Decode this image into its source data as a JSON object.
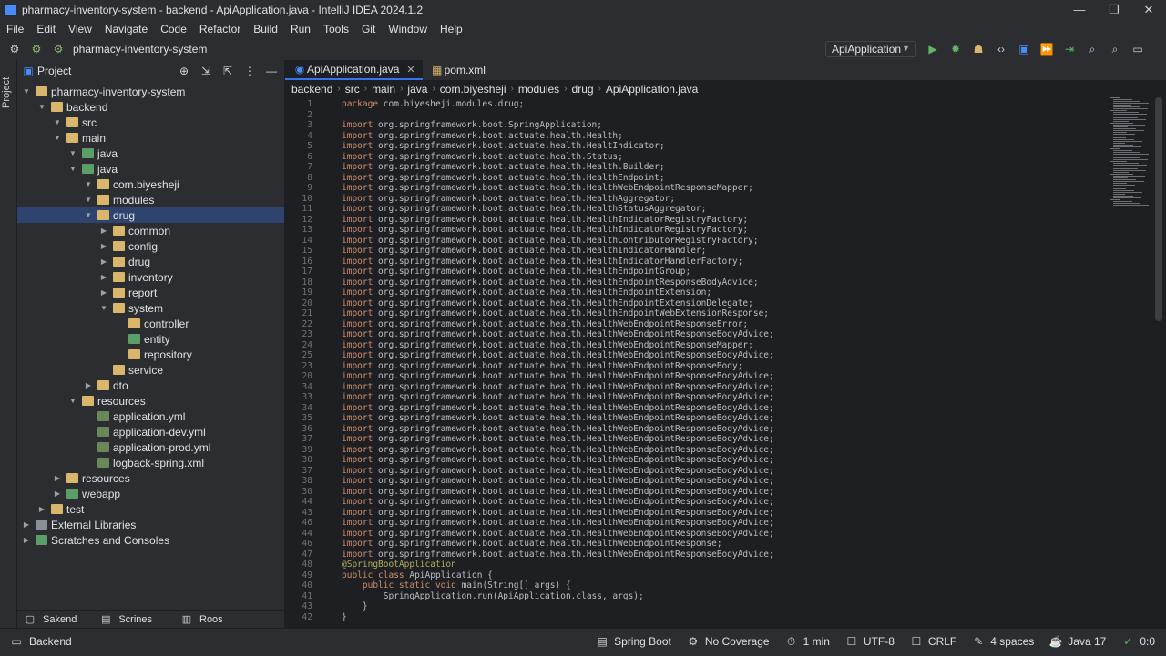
{
  "window": {
    "title": "pharmacy-inventory-system - backend - ApiApplication.java - IntelliJ IDEA 2024.1.2",
    "controls": [
      "—",
      "❐",
      "✕"
    ]
  },
  "menu": [
    "File",
    "Edit",
    "View",
    "Navigate",
    "Code",
    "Refactor",
    "Build",
    "Run",
    "Tools",
    "Git",
    "Window",
    "Help"
  ],
  "toolbar": {
    "project_name": "pharmacy-inventory-system",
    "run_config": "ApiApplication"
  },
  "left_strip": {
    "label": "Project"
  },
  "project_panel": {
    "title": "Project",
    "tree": [
      {
        "label": "pharmacy-inventory-system",
        "depth": 0,
        "arrow": "v",
        "icon": "folder"
      },
      {
        "label": "backend",
        "depth": 1,
        "arrow": "v",
        "icon": "folder"
      },
      {
        "label": "src",
        "depth": 2,
        "arrow": "v",
        "icon": "folder"
      },
      {
        "label": "main",
        "depth": 2,
        "arrow": "v",
        "icon": "folder"
      },
      {
        "label": "java",
        "depth": 3,
        "arrow": "v",
        "icon": "srcfolder"
      },
      {
        "label": "java",
        "depth": 3,
        "arrow": "v",
        "icon": "srcfolder"
      },
      {
        "label": "com.biyesheji",
        "depth": 4,
        "arrow": "v",
        "icon": "folder"
      },
      {
        "label": "modules",
        "depth": 4,
        "arrow": "v",
        "icon": "folder"
      },
      {
        "label": "drug",
        "depth": 4,
        "arrow": "v",
        "icon": "folder",
        "selected": true
      },
      {
        "label": "common",
        "depth": 5,
        "arrow": ">",
        "icon": "folder"
      },
      {
        "label": "config",
        "depth": 5,
        "arrow": ">",
        "icon": "folder"
      },
      {
        "label": "drug",
        "depth": 5,
        "arrow": ">",
        "icon": "folder"
      },
      {
        "label": "inventory",
        "depth": 5,
        "arrow": ">",
        "icon": "folder"
      },
      {
        "label": "report",
        "depth": 5,
        "arrow": ">",
        "icon": "folder"
      },
      {
        "label": "system",
        "depth": 5,
        "arrow": "v",
        "icon": "folder"
      },
      {
        "label": "controller",
        "depth": 6,
        "arrow": "",
        "icon": "folder"
      },
      {
        "label": "entity",
        "depth": 6,
        "arrow": "",
        "icon": "srcfolder"
      },
      {
        "label": "repository",
        "depth": 6,
        "arrow": "",
        "icon": "folder"
      },
      {
        "label": "service",
        "depth": 5,
        "arrow": "",
        "icon": "folder"
      },
      {
        "label": "dto",
        "depth": 4,
        "arrow": ">",
        "icon": "folder"
      },
      {
        "label": "resources",
        "depth": 3,
        "arrow": "v",
        "icon": "folder"
      },
      {
        "label": "application.yml",
        "depth": 4,
        "arrow": "",
        "icon": "yml"
      },
      {
        "label": "application-dev.yml",
        "depth": 4,
        "arrow": "",
        "icon": "yml"
      },
      {
        "label": "application-prod.yml",
        "depth": 4,
        "arrow": "",
        "icon": "yml"
      },
      {
        "label": "logback-spring.xml",
        "depth": 4,
        "arrow": "",
        "icon": "yml"
      },
      {
        "label": "resources",
        "depth": 2,
        "arrow": ">",
        "icon": "folder"
      },
      {
        "label": "webapp",
        "depth": 2,
        "arrow": ">",
        "icon": "srcfolder"
      },
      {
        "label": "test",
        "depth": 1,
        "arrow": ">",
        "icon": "folder"
      },
      {
        "label": "External Libraries",
        "depth": 0,
        "arrow": ">",
        "icon": "libicon"
      },
      {
        "label": "Scratches and Consoles",
        "depth": 0,
        "arrow": ">",
        "icon": "srcfolder"
      }
    ]
  },
  "bottom_tabs": [
    "Sakend",
    "Scrines",
    "Roos"
  ],
  "editor": {
    "tabs": [
      {
        "label": "ApiApplication.java",
        "active": true
      },
      {
        "label": "pom.xml",
        "active": false
      }
    ],
    "breadcrumb": [
      "backend",
      "src",
      "main",
      "java",
      "com.biyesheji",
      "modules",
      "drug",
      "ApiApplication.java"
    ],
    "lines": [
      {
        "n": "1",
        "text": "package com.biyesheji.modules.drug;"
      },
      {
        "n": "2",
        "text": ""
      },
      {
        "n": "3",
        "text": "import org.springframework.boot.SpringApplication;"
      },
      {
        "n": "4",
        "text": "import org.springframework.boot.actuate.health.Health;"
      },
      {
        "n": "5",
        "text": "import org.springframework.boot.actuate.health.HealtIndicator;"
      },
      {
        "n": "6",
        "text": "import org.springframework.boot.actuate.health.Status;"
      },
      {
        "n": "7",
        "text": "import org.springframework.boot.actuate.health.Health.Builder;"
      },
      {
        "n": "8",
        "text": "import org.springframework.boot.actuate.health.HealthEndpoint;"
      },
      {
        "n": "9",
        "text": "import org.springframework.boot.actuate.health.HealthWebEndpointResponseMapper;"
      },
      {
        "n": "10",
        "text": "import org.springframework.boot.actuate.health.HealthAggregator;"
      },
      {
        "n": "11",
        "text": "import org.springframework.boot.actuate.health.HealthStatusAggregator;"
      },
      {
        "n": "12",
        "text": "import org.springframework.boot.actuate.health.HealthIndicatorRegistryFactory;"
      },
      {
        "n": "13",
        "text": "import org.springframework.boot.actuate.health.HealthIndicatorRegistryFactory;"
      },
      {
        "n": "14",
        "text": "import org.springframework.boot.actuate.health.HealthContributorRegistryFactory;"
      },
      {
        "n": "15",
        "text": "import org.springframework.boot.actuate.health.HealthIndicatorHandler;"
      },
      {
        "n": "16",
        "text": "import org.springframework.boot.actuate.health.HealthIndicatorHandlerFactory;"
      },
      {
        "n": "17",
        "text": "import org.springframework.boot.actuate.health.HealthEndpointGroup;"
      },
      {
        "n": "18",
        "text": "import org.springframework.boot.actuate.health.HealthEndpointResponseBodyAdvice;"
      },
      {
        "n": "19",
        "text": "import org.springframework.boot.actuate.health.HealthEndpointExtension;"
      },
      {
        "n": "20",
        "text": "import org.springframework.boot.actuate.health.HealthEndpointExtensionDelegate;"
      },
      {
        "n": "21",
        "text": "import org.springframework.boot.actuate.health.HealthEndpointWebExtensionResponse;"
      },
      {
        "n": "22",
        "text": "import org.springframework.boot.actuate.health.HealthWebEndpointResponseError;"
      },
      {
        "n": "23",
        "text": "import org.springframework.boot.actuate.health.HealthWebEndpointResponseBodyAdvice;"
      },
      {
        "n": "24",
        "text": "import org.springframework.boot.actuate.health.HealthWebEndpointResponseMapper;"
      },
      {
        "n": "25",
        "text": "import org.springframework.boot.actuate.health.HealthWebEndpointResponseBodyAdvice;"
      },
      {
        "n": "23",
        "text": "import org.springframework.boot.actuate.health.HealthWebEndpointResponseBody;"
      },
      {
        "n": "20",
        "text": "import org.springframework.boot.actuate.health.HealthWebEndpointResponseBodyAdvice;"
      },
      {
        "n": "34",
        "text": "import org.springframework.boot.actuate.health.HealthWebEndpointResponseBodyAdvice;"
      },
      {
        "n": "33",
        "text": "import org.springframework.boot.actuate.health.HealthWebEndpointResponseBodyAdvice;"
      },
      {
        "n": "34",
        "text": "import org.springframework.boot.actuate.health.HealthWebEndpointResponseBodyAdvice;"
      },
      {
        "n": "35",
        "text": "import org.springframework.boot.actuate.health.HealthWebEndpointResponseBodyAdvice;"
      },
      {
        "n": "36",
        "text": "import org.springframework.boot.actuate.health.HealthWebEndpointResponseBodyAdvice;"
      },
      {
        "n": "37",
        "text": "import org.springframework.boot.actuate.health.HealthWebEndpointResponseBodyAdvice;"
      },
      {
        "n": "39",
        "text": "import org.springframework.boot.actuate.health.HealthWebEndpointResponseBodyAdvice;"
      },
      {
        "n": "30",
        "text": "import org.springframework.boot.actuate.health.HealthWebEndpointResponseBodyAdvice;"
      },
      {
        "n": "37",
        "text": "import org.springframework.boot.actuate.health.HealthWebEndpointResponseBodyAdvice;"
      },
      {
        "n": "38",
        "text": "import org.springframework.boot.actuate.health.HealthWebEndpointResponseBodyAdvice;"
      },
      {
        "n": "30",
        "text": "import org.springframework.boot.actuate.health.HealthWebEndpointResponseBodyAdvice;"
      },
      {
        "n": "44",
        "text": "import org.springframework.boot.actuate.health.HealthWebEndpointResponseBodyAdvice;"
      },
      {
        "n": "43",
        "text": "import org.springframework.boot.actuate.health.HealthWebEndpointResponseBodyAdvice;"
      },
      {
        "n": "46",
        "text": "import org.springframework.boot.actuate.health.HealthWebEndpointResponseBodyAdvice;"
      },
      {
        "n": "44",
        "text": "import org.springframework.boot.actuate.health.HealthWebEndpointResponseBodyAdvice;"
      },
      {
        "n": "46",
        "text": "import org.springframework.boot.actuate.health.HealthWebEndpointResponse;"
      },
      {
        "n": "47",
        "text": "import org.springframework.boot.actuate.health.HealthWebEndpointResponseBodyAdvice;"
      },
      {
        "n": "48",
        "text": "@SpringBootApplication"
      },
      {
        "n": "49",
        "text": "public class ApiApplication {"
      },
      {
        "n": "40",
        "text": "    public static void main(String[] args) {"
      },
      {
        "n": "41",
        "text": "        SpringApplication.run(ApiApplication.class, args);"
      },
      {
        "n": "43",
        "text": "    }"
      },
      {
        "n": "42",
        "text": "}"
      }
    ]
  },
  "statusbar": {
    "branch": "Backend",
    "items": [
      "Spring Boot",
      "No Coverage",
      "1 min",
      "UTF-8",
      "CRLF",
      "4 spaces",
      "Java 17",
      "0:0"
    ]
  },
  "colors": {
    "accent": "#3574f0",
    "selection": "#2e436e",
    "keyword": "#cf8e6d",
    "ok": "#5fb865"
  }
}
